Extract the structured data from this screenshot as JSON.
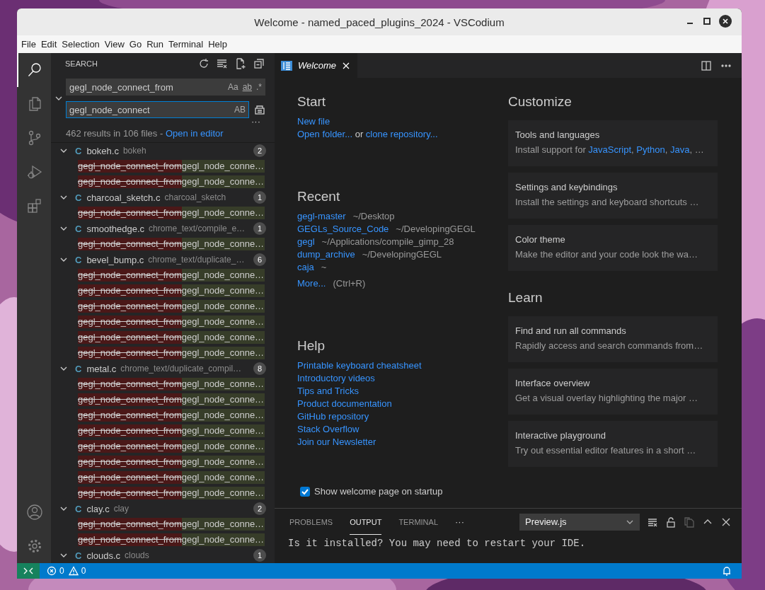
{
  "window": {
    "title": "Welcome - named_paced_plugins_2024 - VSCodium"
  },
  "menu": [
    "File",
    "Edit",
    "Selection",
    "View",
    "Go",
    "Run",
    "Terminal",
    "Help"
  ],
  "activity_bar": [
    {
      "kind": "search",
      "selected": true
    },
    {
      "kind": "explorer",
      "selected": false
    },
    {
      "kind": "scm",
      "selected": false
    },
    {
      "kind": "debug",
      "selected": false
    },
    {
      "kind": "extensions",
      "selected": false
    }
  ],
  "activity_bar_bottom": [
    {
      "kind": "account"
    },
    {
      "kind": "gear"
    }
  ],
  "sidebar": {
    "title": "SEARCH",
    "search": {
      "value": "gegl_node_connect_from",
      "options": [
        "Aa",
        "ab",
        ".*"
      ]
    },
    "replace": {
      "value": "gegl_node_connect",
      "option": "AB"
    },
    "more": "···",
    "summary": "462 results in 106 files - ",
    "summary_link": "Open in editor",
    "results": [
      {
        "icon": "C",
        "file": "bokeh.c",
        "path": "bokeh",
        "count": "2",
        "matches": [
          {
            "removed": "gegl_node_connect_from",
            "added": "gegl_node_conne…"
          },
          {
            "removed": "gegl_node_connect_from",
            "added": "gegl_node_conne…"
          }
        ]
      },
      {
        "icon": "C",
        "file": "charcoal_sketch.c",
        "path": "charcoal_sketch",
        "count": "1",
        "matches": [
          {
            "removed": "gegl_node_connect_from",
            "added": "gegl_node_conne…"
          }
        ]
      },
      {
        "icon": "C",
        "file": "smoothedge.c",
        "path": "chrome_text/compile_e…",
        "count": "1",
        "matches": [
          {
            "removed": "gegl_node_connect_from",
            "added": "gegl_node_conne…"
          }
        ]
      },
      {
        "icon": "C",
        "file": "bevel_bump.c",
        "path": "chrome_text/duplicate_…",
        "count": "6",
        "matches": [
          {
            "removed": "gegl_node_connect_from",
            "added": "gegl_node_conne…"
          },
          {
            "removed": "gegl_node_connect_from",
            "added": "gegl_node_conne…"
          },
          {
            "removed": "gegl_node_connect_from",
            "added": "gegl_node_conne…"
          },
          {
            "removed": "gegl_node_connect_from",
            "added": "gegl_node_conne…"
          },
          {
            "removed": "gegl_node_connect_from",
            "added": "gegl_node_conne…"
          },
          {
            "removed": "gegl_node_connect_from",
            "added": "gegl_node_conne…"
          }
        ]
      },
      {
        "icon": "C",
        "file": "metal.c",
        "path": "chrome_text/duplicate_compil…",
        "count": "8",
        "matches": [
          {
            "removed": "gegl_node_connect_from",
            "added": "gegl_node_conne…"
          },
          {
            "removed": "gegl_node_connect_from",
            "added": "gegl_node_conne…"
          },
          {
            "removed": "gegl_node_connect_from",
            "added": "gegl_node_conne…"
          },
          {
            "removed": "gegl_node_connect_from",
            "added": "gegl_node_conne…"
          },
          {
            "removed": "gegl_node_connect_from",
            "added": "gegl_node_conne…"
          },
          {
            "removed": "gegl_node_connect_from",
            "added": "gegl_node_conne…"
          },
          {
            "removed": "gegl_node_connect_from",
            "added": "gegl_node_conne…"
          },
          {
            "removed": "gegl_node_connect_from",
            "added": "gegl_node_conne…"
          }
        ]
      },
      {
        "icon": "C",
        "file": "clay.c",
        "path": "clay",
        "count": "2",
        "matches": [
          {
            "removed": "gegl_node_connect_from",
            "added": "gegl_node_conne…"
          },
          {
            "removed": "gegl_node_connect_from",
            "added": "gegl_node_conne…"
          }
        ]
      },
      {
        "icon": "C",
        "file": "clouds.c",
        "path": "clouds",
        "count": "1"
      }
    ]
  },
  "editor": {
    "tabs": [
      {
        "label": "Welcome",
        "selected": true
      }
    ],
    "welcome": {
      "start": {
        "heading": "Start",
        "lines": [
          [
            {
              "text": "New file",
              "kind": "link"
            }
          ],
          [
            {
              "text": "Open folder...",
              "kind": "link"
            },
            {
              "text": " or ",
              "kind": "plain"
            },
            {
              "text": "clone repository...",
              "kind": "link"
            }
          ]
        ]
      },
      "recent": {
        "heading": "Recent",
        "items": [
          {
            "name": "gegl-master",
            "path": "~/Desktop"
          },
          {
            "name": "GEGLs_Source_Code",
            "path": "~/DevelopingGEGL"
          },
          {
            "name": "gegl",
            "path": "~/Applications/compile_gimp_28"
          },
          {
            "name": "dump_archive",
            "path": "~/DevelopingGEGL"
          },
          {
            "name": "caja",
            "path": "~"
          }
        ],
        "more": "More...",
        "shortcut": "(Ctrl+R)"
      },
      "help": {
        "heading": "Help",
        "links": [
          "Printable keyboard cheatsheet",
          "Introductory videos",
          "Tips and Tricks",
          "Product documentation",
          "GitHub repository",
          "Stack Overflow",
          "Join our Newsletter"
        ]
      },
      "customize": {
        "heading": "Customize",
        "cards": [
          {
            "title": "Tools and languages",
            "description": [
              {
                "text": "Install support for ",
                "kind": "plain"
              },
              {
                "text": "JavaScript",
                "kind": "link"
              },
              {
                "text": ", ",
                "kind": "plain"
              },
              {
                "text": "Python",
                "kind": "link"
              },
              {
                "text": ", ",
                "kind": "plain"
              },
              {
                "text": "Java",
                "kind": "link"
              },
              {
                "text": ", …",
                "kind": "plain"
              }
            ]
          },
          {
            "title": "Settings and keybindings",
            "description": [
              {
                "text": "Install the settings and keyboard shortcuts …",
                "kind": "plain"
              }
            ]
          },
          {
            "title": "Color theme",
            "description": [
              {
                "text": "Make the editor and your code look the wa…",
                "kind": "plain"
              }
            ]
          }
        ]
      },
      "learn": {
        "heading": "Learn",
        "cards": [
          {
            "title": "Find and run all commands",
            "description": [
              {
                "text": "Rapidly access and search commands from…",
                "kind": "plain"
              }
            ]
          },
          {
            "title": "Interface overview",
            "description": [
              {
                "text": "Get a visual overlay highlighting the major …",
                "kind": "plain"
              }
            ]
          },
          {
            "title": "Interactive playground",
            "description": [
              {
                "text": "Try out essential editor features in a short …",
                "kind": "plain"
              }
            ]
          }
        ]
      },
      "startup_checkbox": {
        "label": "Show welcome page on startup",
        "checked": true
      }
    }
  },
  "panel": {
    "tabs": [
      {
        "label": "PROBLEMS",
        "selected": false
      },
      {
        "label": "OUTPUT",
        "selected": true
      },
      {
        "label": "TERMINAL",
        "selected": false
      }
    ],
    "more": "···",
    "dropdown": "Preview.js",
    "actions": [
      {
        "kind": "clear",
        "disabled": false
      },
      {
        "kind": "lock",
        "disabled": false
      },
      {
        "kind": "copy",
        "disabled": true
      },
      {
        "kind": "maximize",
        "disabled": false
      },
      {
        "kind": "close",
        "disabled": false
      }
    ],
    "output": "Is it installed? You may need to restart your IDE."
  },
  "status_bar": {
    "errors": "0",
    "warnings": "0"
  }
}
